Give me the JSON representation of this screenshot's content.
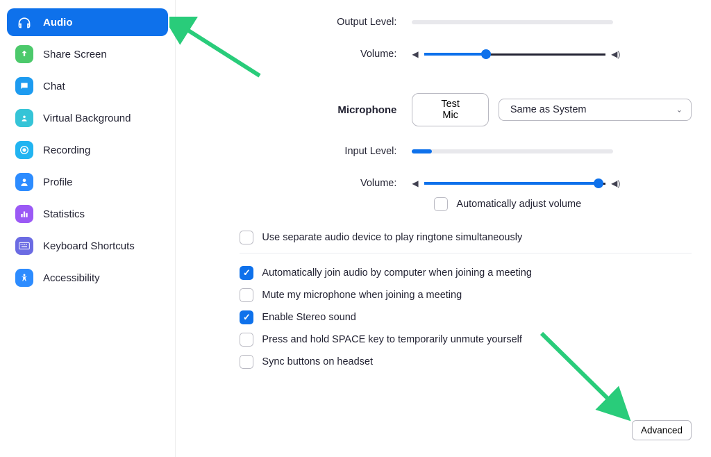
{
  "sidebar": {
    "items": [
      {
        "label": "Audio"
      },
      {
        "label": "Share Screen"
      },
      {
        "label": "Chat"
      },
      {
        "label": "Virtual Background"
      },
      {
        "label": "Recording"
      },
      {
        "label": "Profile"
      },
      {
        "label": "Statistics"
      },
      {
        "label": "Keyboard Shortcuts"
      },
      {
        "label": "Accessibility"
      }
    ]
  },
  "output": {
    "level_label": "Output Level:",
    "volume_label": "Volume:",
    "volume_pct": 34
  },
  "mic": {
    "section_label": "Microphone",
    "test_button": "Test Mic",
    "device_selected": "Same as System",
    "input_level_label": "Input Level:",
    "input_level_pct": 10,
    "volume_label": "Volume:",
    "volume_pct": 96,
    "auto_adjust": "Automatically adjust volume"
  },
  "options": {
    "ringtone": "Use separate audio device to play ringtone simultaneously",
    "auto_join": "Automatically join audio by computer when joining a meeting",
    "mute_join": "Mute my microphone when joining a meeting",
    "stereo": "Enable Stereo sound",
    "space_unmute": "Press and hold SPACE key to temporarily unmute yourself",
    "sync_headset": "Sync buttons on headset"
  },
  "checked": {
    "auto_adjust": false,
    "ringtone": false,
    "auto_join": true,
    "mute_join": false,
    "stereo": true,
    "space_unmute": false,
    "sync_headset": false
  },
  "advanced_button": "Advanced",
  "colors": {
    "accent": "#0E71EB",
    "arrow": "#29CC7A"
  }
}
